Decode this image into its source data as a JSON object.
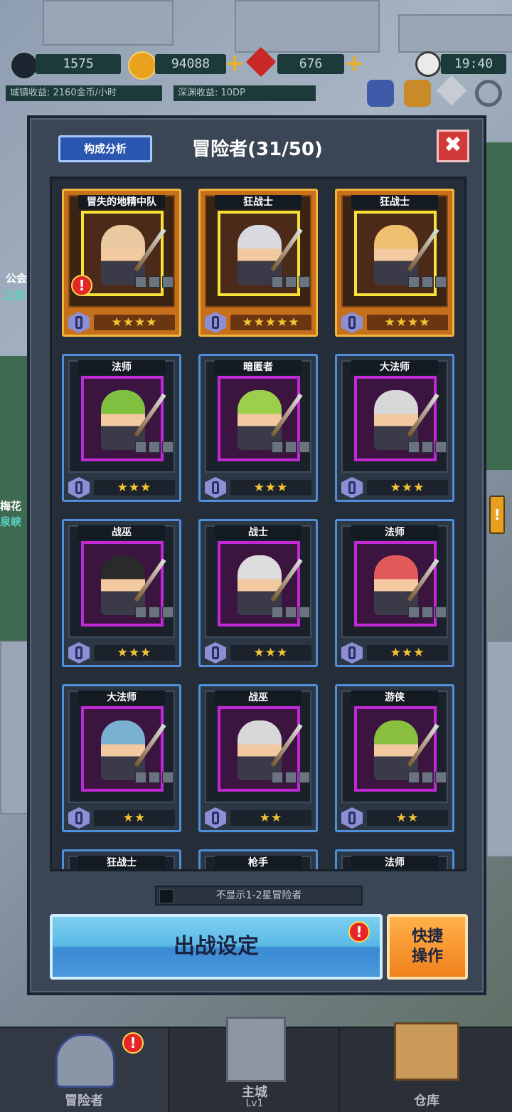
{
  "resources": {
    "power": "1575",
    "gold": "94088",
    "gems": "676",
    "time": "19:40",
    "town_income": "城镇收益: 2160金币/小时",
    "abyss_income": "深渊收益: 10DP"
  },
  "side_labels": {
    "guild": "公会",
    "guild_sub": "之洞",
    "plum": "梅花",
    "plum_sub": "泉峡"
  },
  "panel": {
    "analysis_button": "构成分析",
    "title": "冒险者(31/50)",
    "close": "✖",
    "filter_label": "不显示1-2星冒险者",
    "sortie_button": "出战设定",
    "quick_button_l1": "快捷",
    "quick_button_l2": "操作"
  },
  "cards": [
    {
      "name": "冒失的地精中队",
      "stars": "★★★★",
      "level": "0",
      "gold": true,
      "alert": true
    },
    {
      "name": "狂战士",
      "stars": "★★★★★",
      "level": "0",
      "gold": true
    },
    {
      "name": "狂战士",
      "stars": "★★★★",
      "level": "0",
      "gold": true
    },
    {
      "name": "法师",
      "stars": "★★★",
      "level": "0"
    },
    {
      "name": "暗匿者",
      "stars": "★★★",
      "level": "0"
    },
    {
      "name": "大法师",
      "stars": "★★★",
      "level": "0"
    },
    {
      "name": "战巫",
      "stars": "★★★",
      "level": "0"
    },
    {
      "name": "战士",
      "stars": "★★★",
      "level": "0"
    },
    {
      "name": "法师",
      "stars": "★★★",
      "level": "0"
    },
    {
      "name": "大法师",
      "stars": "★★",
      "level": "0"
    },
    {
      "name": "战巫",
      "stars": "★★",
      "level": "0"
    },
    {
      "name": "游侠",
      "stars": "★★",
      "level": "0"
    },
    {
      "name": "狂战士"
    },
    {
      "name": "枪手"
    },
    {
      "name": "法师"
    }
  ],
  "nav": {
    "adventurer": "冒险者",
    "main_city": "主城",
    "main_city_level": "Lv1",
    "warehouse": "仓库"
  }
}
